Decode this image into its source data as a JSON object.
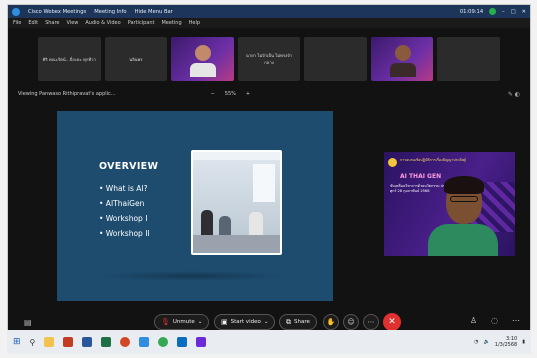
{
  "title_bar": {
    "app_name": "Cisco Webex Meetings",
    "meeting_info": "Meeting Info",
    "hide_menu": "Hide Menu Bar",
    "time": "01:09:14"
  },
  "menu": [
    "File",
    "Edit",
    "Share",
    "View",
    "Audio & Video",
    "Participant",
    "Meeting",
    "Help"
  ],
  "participants": [
    {
      "label": "ศิริ คณะรัตน์...นี่ระยะ ทุกทีวา"
    },
    {
      "label": "นลินพร"
    },
    {
      "label": "",
      "video": true
    },
    {
      "label": "ฉายา ไม่จำเป็น ไม่ทรงจำ กลาง"
    },
    {
      "label": ""
    },
    {
      "label": "",
      "video": true
    },
    {
      "label": ""
    }
  ],
  "share_bar": {
    "viewing": "Viewing Panwaso Rithipravat's applic...",
    "zoom": "55%",
    "zoom_minus": "−",
    "zoom_plus": "+"
  },
  "slide": {
    "heading": "OVERVIEW",
    "bullets": [
      "• What is AI?",
      "• AIThaiGen",
      "• Workshop I",
      "• Workshop II"
    ]
  },
  "speaker": {
    "thai_title": "การอบรมเชิงปฏิบัติการเรื่องปัญญาประดิษฐ์",
    "ai_title": "AI THAI GEN",
    "subtitle": "ขับเคลื่อนวิชาการด้วยนวัตกรรม ประจำวันศุกร์ 28 กุมภาพันธ์ 2568"
  },
  "controls": {
    "unmute": "Unmute",
    "start_video": "Start video",
    "share": "Share"
  },
  "taskbar": {
    "date": "1/3/2568",
    "time": "3:10"
  }
}
